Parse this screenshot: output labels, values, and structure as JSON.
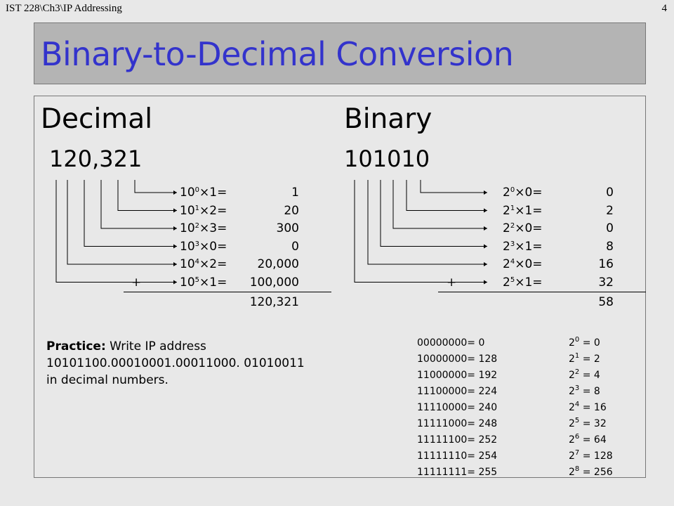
{
  "header": {
    "left": "IST 228\\Ch3\\IP Addressing",
    "right": "4"
  },
  "title": "Binary-to-Decimal Conversion",
  "decimal": {
    "heading": "Decimal",
    "number": "120,321",
    "rows": [
      {
        "base": "10",
        "exp": "0",
        "tail": "×1=",
        "result": "1"
      },
      {
        "base": "10",
        "exp": "1",
        "tail": "×2=",
        "result": "20"
      },
      {
        "base": "10",
        "exp": "2",
        "tail": "×3=",
        "result": "300"
      },
      {
        "base": "10",
        "exp": "3",
        "tail": "×0=",
        "result": "0"
      },
      {
        "base": "10",
        "exp": "4",
        "tail": "×2=",
        "result": "20,000"
      },
      {
        "base": "10",
        "exp": "5",
        "tail": "×1=",
        "result": "100,000"
      }
    ],
    "plus": "+",
    "total": "120,321"
  },
  "binary": {
    "heading": "Binary",
    "number": "101010",
    "rows": [
      {
        "base": "2",
        "exp": "0",
        "tail": "×0=",
        "result": "0"
      },
      {
        "base": "2",
        "exp": "1",
        "tail": "×1=",
        "result": "2"
      },
      {
        "base": "2",
        "exp": "2",
        "tail": "×0=",
        "result": "0"
      },
      {
        "base": "2",
        "exp": "3",
        "tail": "×1=",
        "result": "8"
      },
      {
        "base": "2",
        "exp": "4",
        "tail": "×0=",
        "result": "16"
      },
      {
        "base": "2",
        "exp": "5",
        "tail": "×1=",
        "result": "32"
      }
    ],
    "plus": "+",
    "total": "58"
  },
  "practice": {
    "label": "Practice:",
    "line1": " Write IP address",
    "line2": "10101100.00010001.00011000. 01010011",
    "line3": "in decimal numbers."
  },
  "octets": [
    "00000000= 0",
    "10000000= 128",
    "11000000= 192",
    "11100000= 224",
    "11110000= 240",
    "11111000= 248",
    "11111100= 252",
    "11111110= 254",
    "11111111= 255"
  ],
  "powers": [
    {
      "base": "2",
      "exp": "0",
      "val": " = 0"
    },
    {
      "base": "2",
      "exp": "1",
      "val": " = 2"
    },
    {
      "base": "2",
      "exp": "2",
      "val": " = 4"
    },
    {
      "base": "2",
      "exp": "3",
      "val": " = 8"
    },
    {
      "base": "2",
      "exp": "4",
      "val": " = 16"
    },
    {
      "base": "2",
      "exp": "5",
      "val": " = 32"
    },
    {
      "base": "2",
      "exp": "6",
      "val": " = 64"
    },
    {
      "base": "2",
      "exp": "7",
      "val": " = 128"
    },
    {
      "base": "2",
      "exp": "8",
      "val": " = 256"
    }
  ]
}
